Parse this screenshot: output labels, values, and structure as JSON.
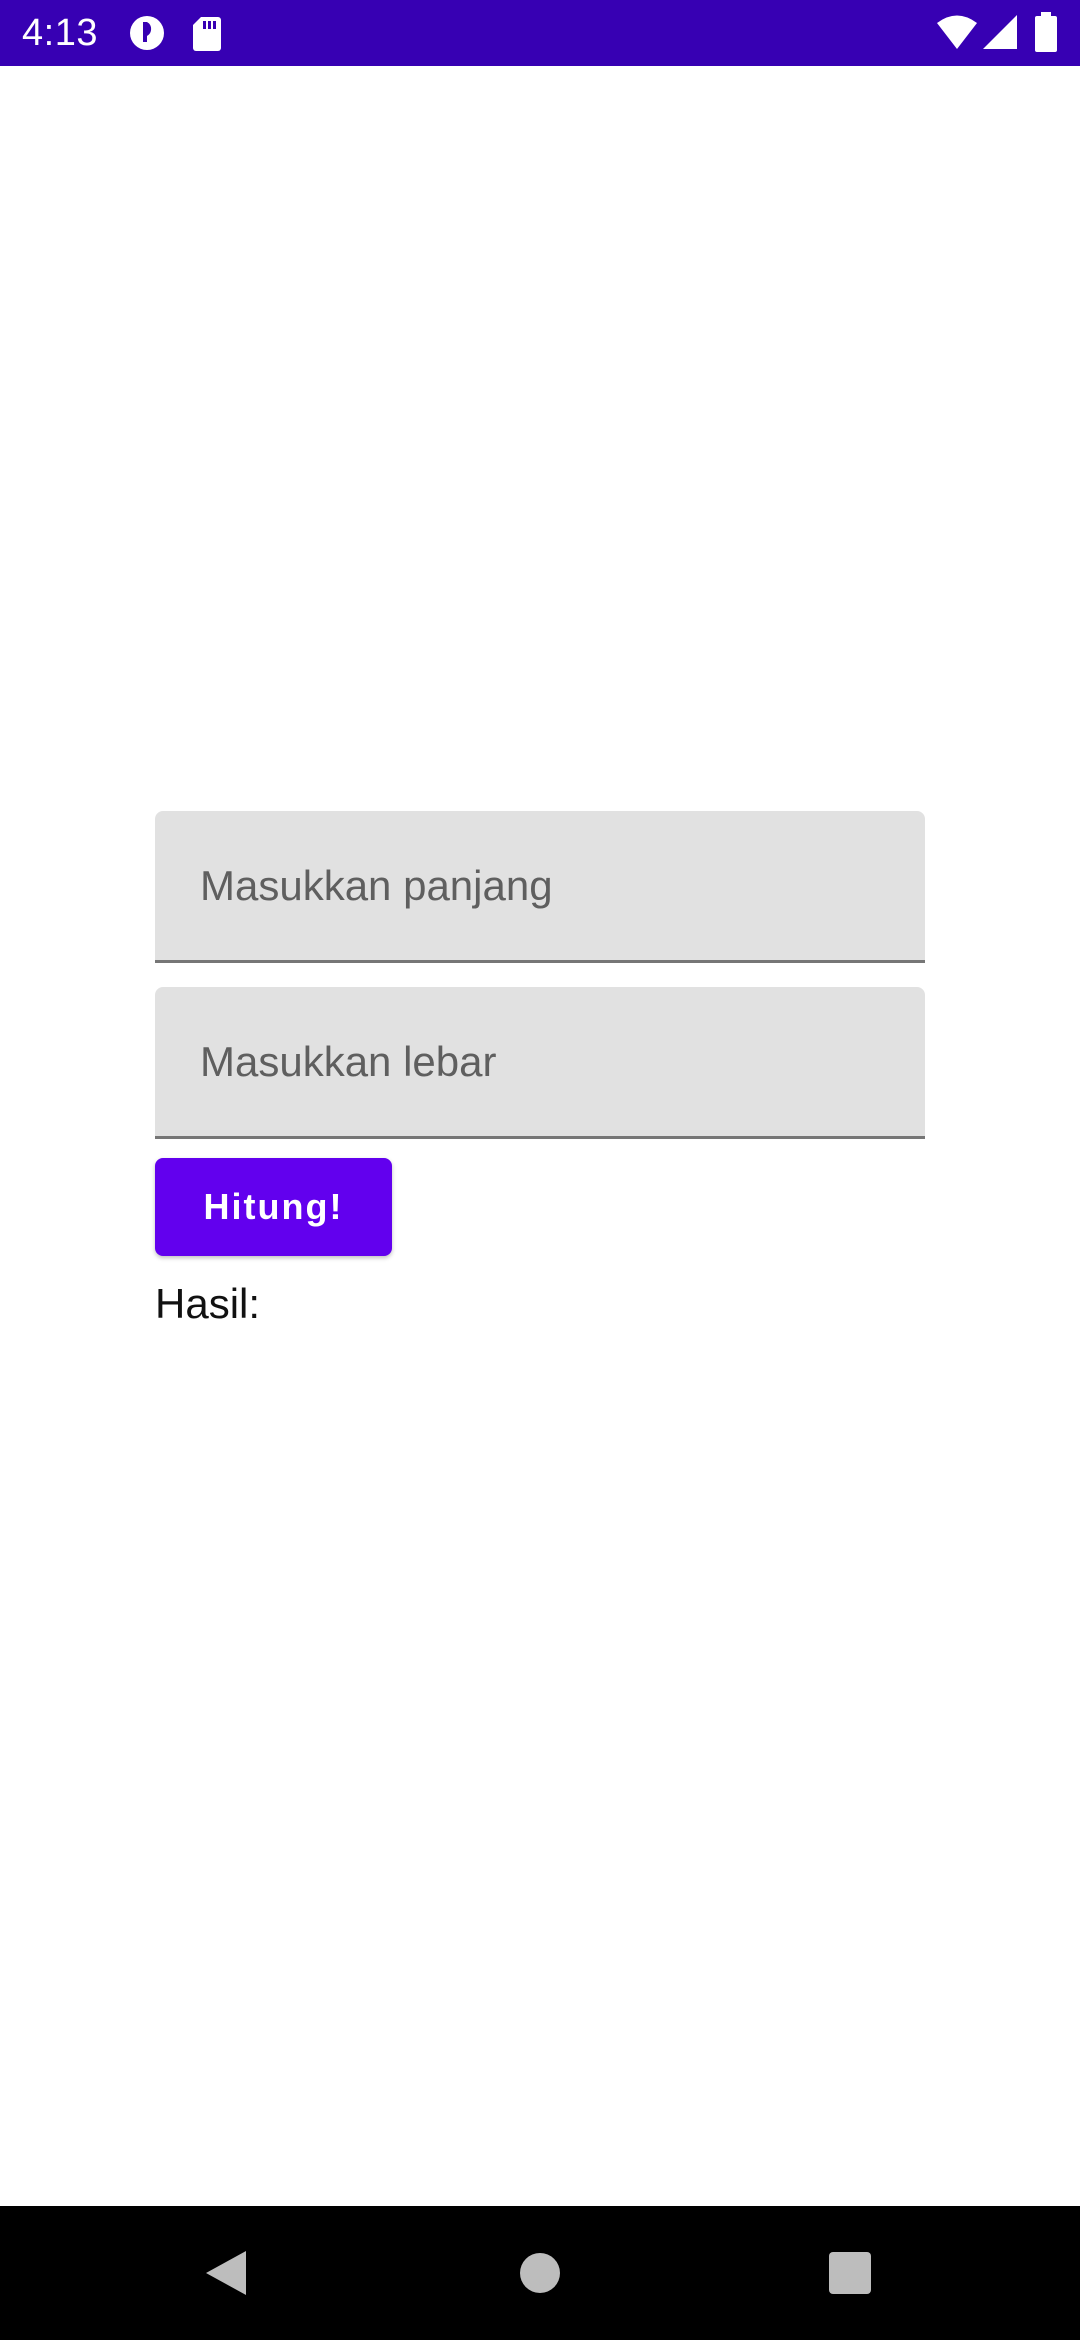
{
  "status_bar": {
    "time": "4:13",
    "background": "#3700b3",
    "left_icons": [
      "media-icon",
      "sd-card-icon"
    ],
    "right_icons": [
      "wifi-icon",
      "cell-signal-icon",
      "battery-icon"
    ]
  },
  "form": {
    "length_placeholder": "Masukkan panjang",
    "width_placeholder": "Masukkan lebar",
    "length_value": "",
    "width_value": "",
    "submit_label": "Hitung!",
    "result_label": "Hasil:"
  },
  "nav_bar": {
    "buttons": [
      "back-icon",
      "home-icon",
      "recents-icon"
    ]
  },
  "colors": {
    "status_bar": "#3700b3",
    "accent": "#6200ee",
    "field_bg": "#e1e1e1",
    "nav_bar": "#000000"
  }
}
